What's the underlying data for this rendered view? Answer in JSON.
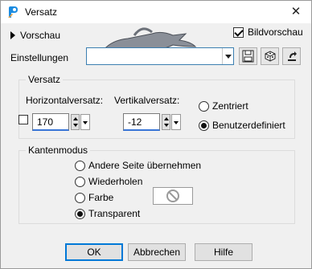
{
  "window": {
    "title": "Versatz",
    "close_glyph": "✕"
  },
  "preview": {
    "label": "Vorschau",
    "image_preview_label": "Bildvorschau",
    "image_preview_checked": true
  },
  "settings": {
    "label": "Einstellungen",
    "value": ""
  },
  "offset": {
    "group_title": "Versatz",
    "horizontal_label": "Horizontalversatz:",
    "horizontal_value": "170",
    "vertical_label": "Vertikalversatz:",
    "vertical_value": "-12",
    "link_checked": false,
    "options": [
      {
        "label": "Zentriert",
        "selected": false
      },
      {
        "label": "Benutzerdefiniert",
        "selected": true
      }
    ]
  },
  "edge_mode": {
    "group_title": "Kantenmodus",
    "options": [
      {
        "label": "Andere Seite übernehmen",
        "selected": false
      },
      {
        "label": "Wiederholen",
        "selected": false
      },
      {
        "label": "Farbe",
        "selected": false
      },
      {
        "label": "Transparent",
        "selected": true
      }
    ],
    "color_swatch_icon": "no-color-icon"
  },
  "buttons": {
    "ok": "OK",
    "cancel": "Abbrechen",
    "help": "Hilfe"
  },
  "colors": {
    "accent": "#0078d7",
    "input_underline": "#3875d7"
  }
}
